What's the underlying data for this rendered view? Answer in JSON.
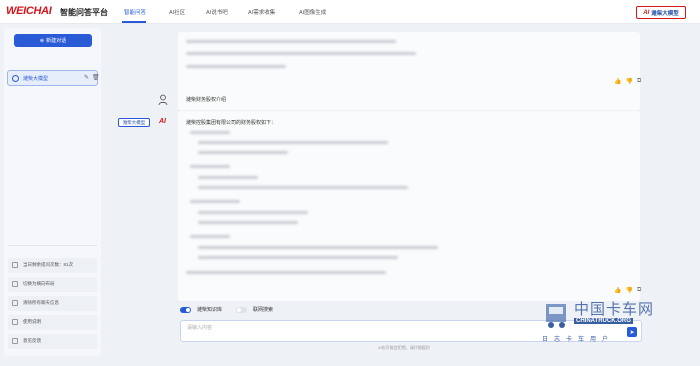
{
  "header": {
    "logo": "WEICHAI",
    "title": "智能问答平台",
    "tabs": [
      {
        "label": "智能问答"
      },
      {
        "label": "AI社区"
      },
      {
        "label": "AI说书吧"
      },
      {
        "label": "AI需求收集"
      },
      {
        "label": "AI图像生成"
      }
    ],
    "brand_mark": "AI",
    "brand_name": "潍柴大模型"
  },
  "sidebar": {
    "new_chat_label": "新建对话",
    "conversation": "潍柴大模型",
    "links": [
      {
        "label": "当日剩余提问次数：81次"
      },
      {
        "label": "切换为横向布局"
      },
      {
        "label": "清除所有聊天信息"
      },
      {
        "label": "使用说明"
      },
      {
        "label": "意见反馈"
      }
    ]
  },
  "chat": {
    "user_question": "潍柴财务股权介绍",
    "ai_label": "潍柴大模型",
    "ai_logo": "AI",
    "ai_intro": "潍柴控股集团有限公司的财务股权如下："
  },
  "input": {
    "toggle_knowledge": "潍柴知识库",
    "toggle_web": "联网搜索",
    "placeholder": "请输入内容",
    "disclaimer": "AI也可能会犯错，请仔细甄别"
  },
  "watermark": {
    "title": "中国卡车网",
    "sub": "CHINATRUCK.ORG",
    "tag": "日志卡车用户"
  },
  "colors": {
    "accent": "#2a5bd7",
    "brand_red": "#d5161c"
  }
}
